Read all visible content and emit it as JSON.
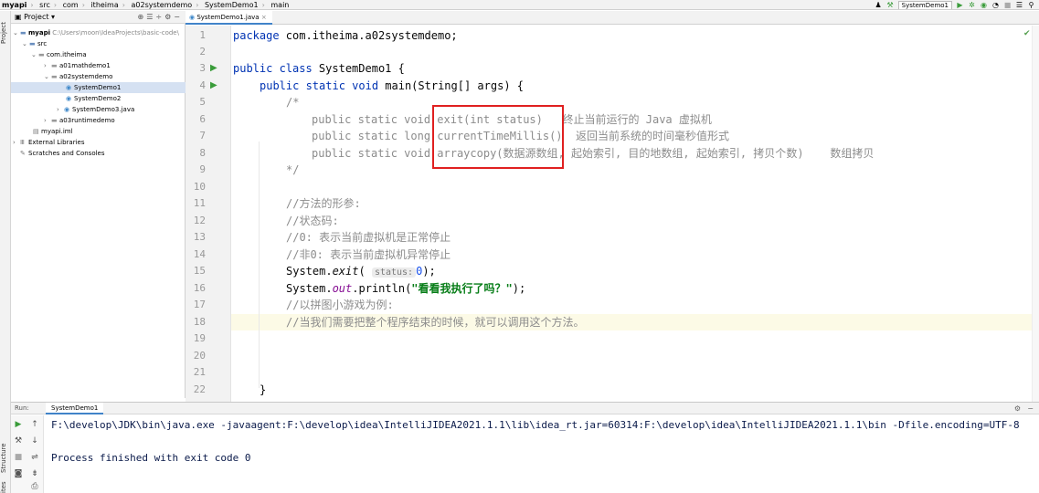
{
  "breadcrumb": [
    "myapi",
    "src",
    "com",
    "itheima",
    "a02systemdemo",
    "SystemDemo1",
    "main"
  ],
  "run_config": "SystemDemo1",
  "project_panel": {
    "title": "Project",
    "tree": [
      {
        "label": "myapi",
        "detail": "C:\\Users\\moon\\IdeaProjects\\basic-code\\",
        "bold": true
      },
      {
        "label": "src"
      },
      {
        "label": "com.itheima"
      },
      {
        "label": "a01mathdemo1"
      },
      {
        "label": "a02systemdemo"
      },
      {
        "label": "SystemDemo1",
        "selected": true
      },
      {
        "label": "SystemDemo2"
      },
      {
        "label": "SystemDemo3.java"
      },
      {
        "label": "a03runtimedemo"
      },
      {
        "label": "myapi.iml"
      },
      {
        "label": "External Libraries"
      },
      {
        "label": "Scratches and Consoles"
      }
    ]
  },
  "side_tabs": {
    "project": "Project",
    "structure": "Structure",
    "favorites": "ites"
  },
  "editor": {
    "tab_label": "SystemDemo1.java",
    "line_numbers": [
      "1",
      "2",
      "3",
      "4",
      "5",
      "6",
      "7",
      "8",
      "9",
      "10",
      "11",
      "12",
      "13",
      "14",
      "15",
      "16",
      "17",
      "18",
      "19",
      "20",
      "21",
      "22"
    ],
    "code": {
      "l1_kw": "package",
      "l1_rest": " com.itheima.a02systemdemo;",
      "l3_kw": "public class",
      "l3_rest": " SystemDemo1 {",
      "l4_kw": "public static void",
      "l4_rest": " main(String[] args) {",
      "l5": "/*",
      "l6": "public static void exit(int status)   终止当前运行的 Java 虚拟机",
      "l7": "public static long currentTimeMillis()  返回当前系统的时间毫秒值形式",
      "l8": "public static void arraycopy(数据源数组, 起始索引, 目的地数组, 起始索引, 拷贝个数)    数组拷贝",
      "l9": "*/",
      "l11": "//方法的形参:",
      "l12": "//状态码:",
      "l13": "//0: 表示当前虚拟机是正常停止",
      "l14": "//非0: 表示当前虚拟机异常停止",
      "l15_a": "System.",
      "l15_method": "exit",
      "l15_b": "( ",
      "l15_hint": "status:",
      "l15_num": "0",
      "l15_c": ");",
      "l16_a": "System.",
      "l16_field": "out",
      "l16_b": ".println(",
      "l16_str": "\"看看我执行了吗？\"",
      "l16_c": ");",
      "l17": "//以拼图小游戏为例:",
      "l18": "//当我们需要把整个程序结束的时候，就可以调用这个方法。",
      "l22": "}"
    }
  },
  "run_panel": {
    "label": "Run:",
    "tab": "SystemDemo1",
    "console": [
      "F:\\develop\\JDK\\bin\\java.exe -javaagent:F:\\develop\\idea\\IntelliJIDEA2021.1.1\\lib\\idea_rt.jar=60314:F:\\develop\\idea\\IntelliJIDEA2021.1.1\\bin -Dfile.encoding=UTF-8",
      "",
      "Process finished with exit code 0"
    ]
  },
  "colors": {
    "keyword": "#0033b3",
    "comment": "#8c8c8c",
    "string": "#067d17",
    "highlight_box": "#e02020"
  }
}
